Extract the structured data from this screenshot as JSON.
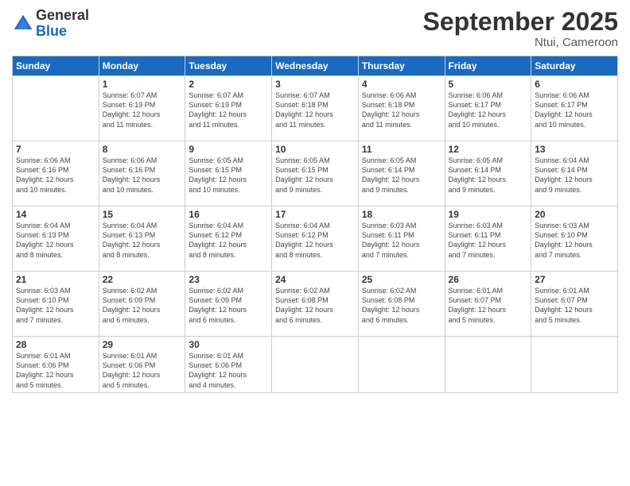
{
  "logo": {
    "general": "General",
    "blue": "Blue"
  },
  "title": "September 2025",
  "location": "Ntui, Cameroon",
  "days_of_week": [
    "Sunday",
    "Monday",
    "Tuesday",
    "Wednesday",
    "Thursday",
    "Friday",
    "Saturday"
  ],
  "weeks": [
    [
      {
        "day": "",
        "sunrise": "",
        "sunset": "",
        "daylight": ""
      },
      {
        "day": "1",
        "sunrise": "Sunrise: 6:07 AM",
        "sunset": "Sunset: 6:19 PM",
        "daylight": "Daylight: 12 hours and 11 minutes."
      },
      {
        "day": "2",
        "sunrise": "Sunrise: 6:07 AM",
        "sunset": "Sunset: 6:19 PM",
        "daylight": "Daylight: 12 hours and 11 minutes."
      },
      {
        "day": "3",
        "sunrise": "Sunrise: 6:07 AM",
        "sunset": "Sunset: 6:18 PM",
        "daylight": "Daylight: 12 hours and 11 minutes."
      },
      {
        "day": "4",
        "sunrise": "Sunrise: 6:06 AM",
        "sunset": "Sunset: 6:18 PM",
        "daylight": "Daylight: 12 hours and 11 minutes."
      },
      {
        "day": "5",
        "sunrise": "Sunrise: 6:06 AM",
        "sunset": "Sunset: 6:17 PM",
        "daylight": "Daylight: 12 hours and 10 minutes."
      },
      {
        "day": "6",
        "sunrise": "Sunrise: 6:06 AM",
        "sunset": "Sunset: 6:17 PM",
        "daylight": "Daylight: 12 hours and 10 minutes."
      }
    ],
    [
      {
        "day": "7",
        "sunrise": "Sunrise: 6:06 AM",
        "sunset": "Sunset: 6:16 PM",
        "daylight": "Daylight: 12 hours and 10 minutes."
      },
      {
        "day": "8",
        "sunrise": "Sunrise: 6:06 AM",
        "sunset": "Sunset: 6:16 PM",
        "daylight": "Daylight: 12 hours and 10 minutes."
      },
      {
        "day": "9",
        "sunrise": "Sunrise: 6:05 AM",
        "sunset": "Sunset: 6:15 PM",
        "daylight": "Daylight: 12 hours and 10 minutes."
      },
      {
        "day": "10",
        "sunrise": "Sunrise: 6:05 AM",
        "sunset": "Sunset: 6:15 PM",
        "daylight": "Daylight: 12 hours and 9 minutes."
      },
      {
        "day": "11",
        "sunrise": "Sunrise: 6:05 AM",
        "sunset": "Sunset: 6:14 PM",
        "daylight": "Daylight: 12 hours and 9 minutes."
      },
      {
        "day": "12",
        "sunrise": "Sunrise: 6:05 AM",
        "sunset": "Sunset: 6:14 PM",
        "daylight": "Daylight: 12 hours and 9 minutes."
      },
      {
        "day": "13",
        "sunrise": "Sunrise: 6:04 AM",
        "sunset": "Sunset: 6:14 PM",
        "daylight": "Daylight: 12 hours and 9 minutes."
      }
    ],
    [
      {
        "day": "14",
        "sunrise": "Sunrise: 6:04 AM",
        "sunset": "Sunset: 6:13 PM",
        "daylight": "Daylight: 12 hours and 8 minutes."
      },
      {
        "day": "15",
        "sunrise": "Sunrise: 6:04 AM",
        "sunset": "Sunset: 6:13 PM",
        "daylight": "Daylight: 12 hours and 8 minutes."
      },
      {
        "day": "16",
        "sunrise": "Sunrise: 6:04 AM",
        "sunset": "Sunset: 6:12 PM",
        "daylight": "Daylight: 12 hours and 8 minutes."
      },
      {
        "day": "17",
        "sunrise": "Sunrise: 6:04 AM",
        "sunset": "Sunset: 6:12 PM",
        "daylight": "Daylight: 12 hours and 8 minutes."
      },
      {
        "day": "18",
        "sunrise": "Sunrise: 6:03 AM",
        "sunset": "Sunset: 6:11 PM",
        "daylight": "Daylight: 12 hours and 7 minutes."
      },
      {
        "day": "19",
        "sunrise": "Sunrise: 6:03 AM",
        "sunset": "Sunset: 6:11 PM",
        "daylight": "Daylight: 12 hours and 7 minutes."
      },
      {
        "day": "20",
        "sunrise": "Sunrise: 6:03 AM",
        "sunset": "Sunset: 6:10 PM",
        "daylight": "Daylight: 12 hours and 7 minutes."
      }
    ],
    [
      {
        "day": "21",
        "sunrise": "Sunrise: 6:03 AM",
        "sunset": "Sunset: 6:10 PM",
        "daylight": "Daylight: 12 hours and 7 minutes."
      },
      {
        "day": "22",
        "sunrise": "Sunrise: 6:02 AM",
        "sunset": "Sunset: 6:09 PM",
        "daylight": "Daylight: 12 hours and 6 minutes."
      },
      {
        "day": "23",
        "sunrise": "Sunrise: 6:02 AM",
        "sunset": "Sunset: 6:09 PM",
        "daylight": "Daylight: 12 hours and 6 minutes."
      },
      {
        "day": "24",
        "sunrise": "Sunrise: 6:02 AM",
        "sunset": "Sunset: 6:08 PM",
        "daylight": "Daylight: 12 hours and 6 minutes."
      },
      {
        "day": "25",
        "sunrise": "Sunrise: 6:02 AM",
        "sunset": "Sunset: 6:08 PM",
        "daylight": "Daylight: 12 hours and 6 minutes."
      },
      {
        "day": "26",
        "sunrise": "Sunrise: 6:01 AM",
        "sunset": "Sunset: 6:07 PM",
        "daylight": "Daylight: 12 hours and 5 minutes."
      },
      {
        "day": "27",
        "sunrise": "Sunrise: 6:01 AM",
        "sunset": "Sunset: 6:07 PM",
        "daylight": "Daylight: 12 hours and 5 minutes."
      }
    ],
    [
      {
        "day": "28",
        "sunrise": "Sunrise: 6:01 AM",
        "sunset": "Sunset: 6:06 PM",
        "daylight": "Daylight: 12 hours and 5 minutes."
      },
      {
        "day": "29",
        "sunrise": "Sunrise: 6:01 AM",
        "sunset": "Sunset: 6:06 PM",
        "daylight": "Daylight: 12 hours and 5 minutes."
      },
      {
        "day": "30",
        "sunrise": "Sunrise: 6:01 AM",
        "sunset": "Sunset: 6:06 PM",
        "daylight": "Daylight: 12 hours and 4 minutes."
      },
      {
        "day": "",
        "sunrise": "",
        "sunset": "",
        "daylight": ""
      },
      {
        "day": "",
        "sunrise": "",
        "sunset": "",
        "daylight": ""
      },
      {
        "day": "",
        "sunrise": "",
        "sunset": "",
        "daylight": ""
      },
      {
        "day": "",
        "sunrise": "",
        "sunset": "",
        "daylight": ""
      }
    ]
  ]
}
